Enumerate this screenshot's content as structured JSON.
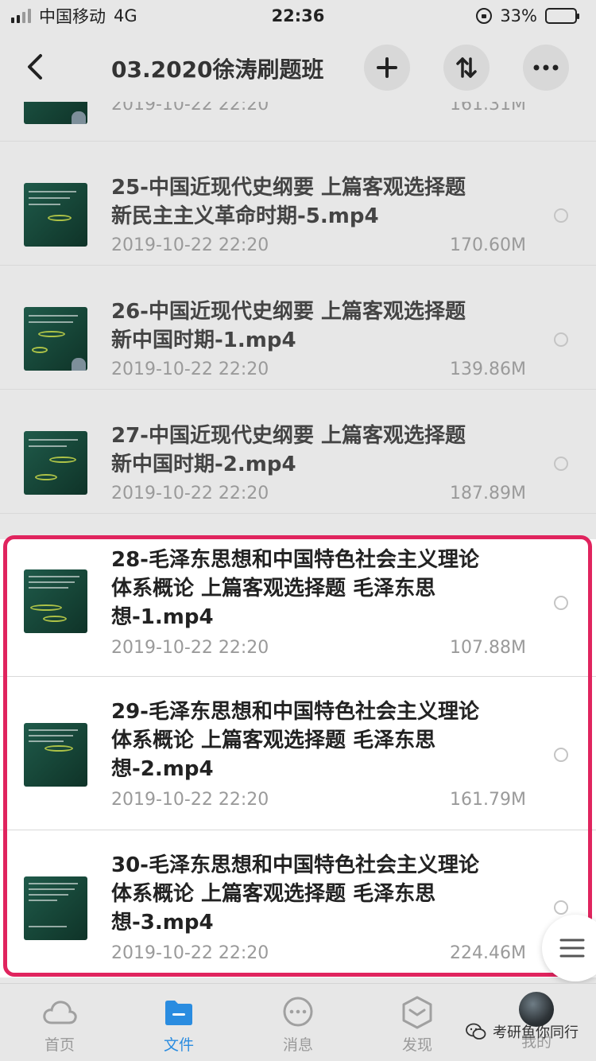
{
  "status_bar": {
    "carrier": "中国移动",
    "network": "4G",
    "time": "22:36",
    "battery": "33%"
  },
  "header": {
    "title": "03.2020徐涛刷题班"
  },
  "files": [
    {
      "name": "",
      "date": "2019-10-22 22:20",
      "size": "161.31M"
    },
    {
      "name": "25-中国近现代史纲要 上篇客观选择题 新民主主义革命时期-5.mp4",
      "date": "2019-10-22 22:20",
      "size": "170.60M"
    },
    {
      "name": "26-中国近现代史纲要 上篇客观选择题 新中国时期-1.mp4",
      "date": "2019-10-22 22:20",
      "size": "139.86M"
    },
    {
      "name": "27-中国近现代史纲要 上篇客观选择题 新中国时期-2.mp4",
      "date": "2019-10-22 22:20",
      "size": "187.89M"
    },
    {
      "name": "28-毛泽东思想和中国特色社会主义理论体系概论 上篇客观选择题 毛泽东思想-1.mp4",
      "date": "2019-10-22 22:20",
      "size": "107.88M"
    },
    {
      "name": "29-毛泽东思想和中国特色社会主义理论体系概论 上篇客观选择题 毛泽东思想-2.mp4",
      "date": "2019-10-22 22:20",
      "size": "161.79M"
    },
    {
      "name": "30-毛泽东思想和中国特色社会主义理论体系概论 上篇客观选择题 毛泽东思想-3.mp4",
      "date": "2019-10-22 22:20",
      "size": "224.46M"
    }
  ],
  "tabs": [
    {
      "label": "首页",
      "icon": "cloud-icon"
    },
    {
      "label": "文件",
      "icon": "folder-icon"
    },
    {
      "label": "消息",
      "icon": "chat-bubble-icon"
    },
    {
      "label": "发现",
      "icon": "compass-hexagon-icon"
    },
    {
      "label": "我的",
      "icon": "avatar"
    }
  ],
  "watermark": "考研鱼你同行",
  "colors": {
    "accent": "#2a8ce0",
    "highlight": "#e0245e",
    "dimmed_background": "#e7e7e7"
  }
}
